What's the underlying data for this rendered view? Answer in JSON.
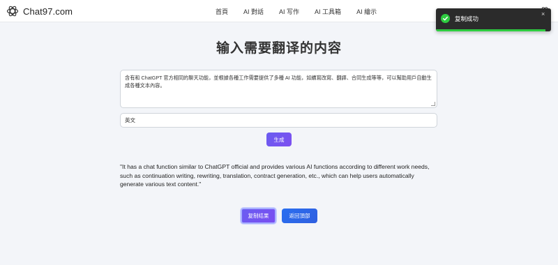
{
  "brand": {
    "name": "Chat97.com"
  },
  "nav": {
    "items": [
      {
        "label": "首頁"
      },
      {
        "label": "AI 對話"
      },
      {
        "label": "AI 写作"
      },
      {
        "label": "AI 工具箱"
      },
      {
        "label": "AI 繪示"
      }
    ]
  },
  "page": {
    "title": "输入需要翻译的内容"
  },
  "source": {
    "text": "含有和 ChatGPT 官方相同的聊天功能，並根據各種工作需要提供了多種 AI 功能，如續寫改寫、翻譯、合同生成等等，可以幫助用戶自動生成各種文本內容。"
  },
  "target_language": {
    "value": "英文"
  },
  "generate_button": {
    "label": "生成"
  },
  "result": {
    "text": "\"It has a chat function similar to ChatGPT official and provides various AI functions according to different work needs, such as continuation writing, rewriting, translation, contract generation, etc., which can help users automatically generate various text content.\""
  },
  "actions": {
    "copy_label": "复制结果",
    "back_label": "返回頂部"
  },
  "toast": {
    "message": "复制成功",
    "progress_fraction": 0.95,
    "close_symbol": "×"
  },
  "colors": {
    "accent_purple": "#6a5cf0",
    "accent_blue": "#2a6ff0",
    "success_green": "#2ecc40",
    "toast_bg": "#2b2b2b"
  },
  "icons": {
    "logo": "openai-logo-icon",
    "settings": "openai-settings-icon",
    "toast_status": "success-check-icon"
  }
}
